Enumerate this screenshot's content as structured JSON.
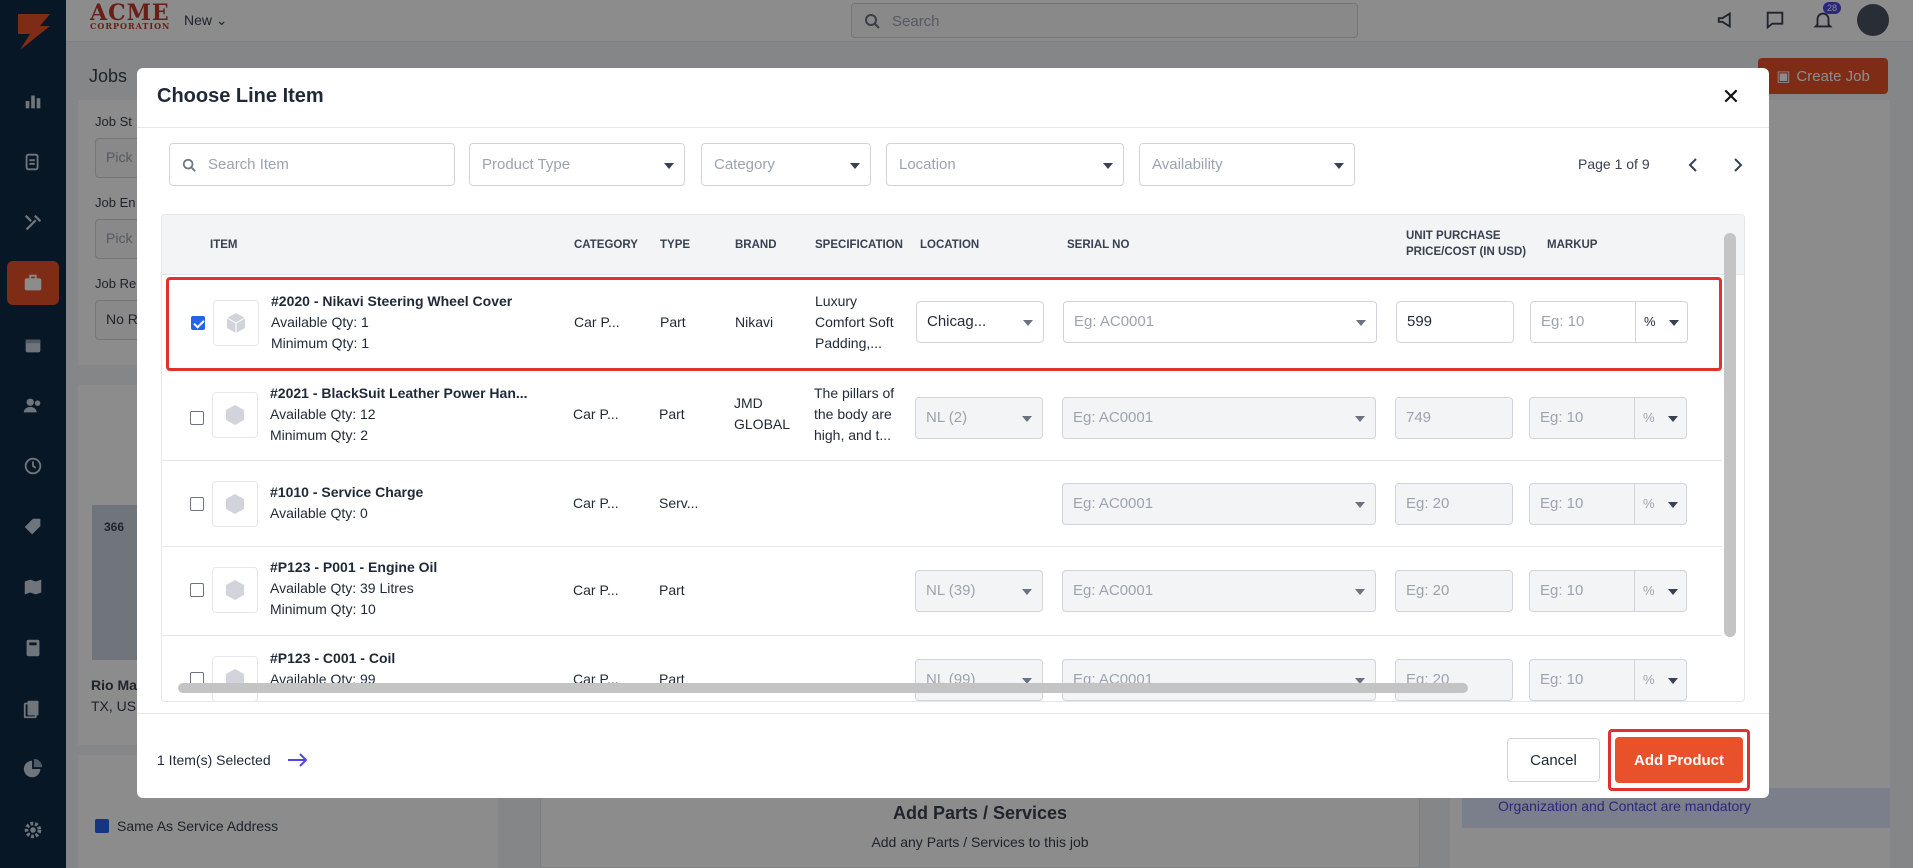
{
  "topbar": {
    "brand": "ACME",
    "brand_sub": "CORPORATION",
    "new_label": "New",
    "search_placeholder": "Search",
    "notification_count": "28"
  },
  "background": {
    "page_title": "Jobs",
    "create_job_label": "Create Job",
    "job_start_label": "Job St",
    "job_start_placeholder": "Pick",
    "job_end_label": "Job En",
    "job_end_placeholder": "Pick",
    "job_re_label": "Job Re",
    "job_re_value": "No R",
    "address_line1": "Rio Ma",
    "address_line2": "TX, US",
    "same_as_service": "Same As Service Address",
    "add_parts_title": "Add Parts / Services",
    "add_parts_sub": "Add any Parts / Services to this job",
    "mandatory_note": "Organization and Contact are mandatory",
    "map_route": "366"
  },
  "modal": {
    "title": "Choose Line Item",
    "filters": {
      "search_placeholder": "Search Item",
      "product_type": "Product Type",
      "category": "Category",
      "location": "Location",
      "availability": "Availability"
    },
    "pager": "Page 1 of 9",
    "columns": {
      "item": "ITEM",
      "category": "CATEGORY",
      "type": "TYPE",
      "brand": "BRAND",
      "specification": "SPECIFICATION",
      "location": "LOCATION",
      "serial": "SERIAL NO",
      "unit_price_l1": "UNIT PURCHASE",
      "unit_price_l2": "PRICE/COST (IN USD)",
      "markup": "MARKUP"
    },
    "rows": [
      {
        "name": "#2020 - Nikavi Steering Wheel Cover",
        "qty": "Available Qty: 1",
        "min": "Minimum Qty: 1",
        "category": "Car P...",
        "type": "Part",
        "brand": "Nikavi",
        "spec1": "Luxury",
        "spec2": "Comfort Soft",
        "spec3": "Padding,...",
        "location": "Chicag...",
        "serial": "Eg: AC0001",
        "price": "599",
        "markup": "Eg: 10",
        "checked": true
      },
      {
        "name": "#2021 - BlackSuit Leather Power Han...",
        "qty": "Available Qty: 12",
        "min": "Minimum Qty: 2",
        "category": "Car P...",
        "type": "Part",
        "brand1": "JMD",
        "brand2": "GLOBAL",
        "spec1": "The pillars of",
        "spec2": "the body are",
        "spec3": "high, and t...",
        "location": "NL (2)",
        "serial": "Eg: AC0001",
        "price": "749",
        "markup": "Eg: 10",
        "checked": false
      },
      {
        "name": "#1010 - Service Charge",
        "qty": "Available Qty: 0",
        "category": "Car P...",
        "type": "Serv...",
        "serial": "Eg: AC0001",
        "price": "Eg: 20",
        "markup": "Eg: 10",
        "checked": false
      },
      {
        "name": "#P123 - P001 - Engine Oil",
        "qty": "Available Qty: 39 Litres",
        "min": "Minimum Qty: 10",
        "category": "Car P...",
        "type": "Part",
        "location": "NL (39)",
        "serial": "Eg: AC0001",
        "price": "Eg: 20",
        "markup": "Eg: 10",
        "checked": false
      },
      {
        "name": "#P123 - C001 - Coil",
        "qty": "Available Qty: 99",
        "category": "Car P...",
        "type": "Part",
        "location": "NL (99)",
        "serial": "Eg: AC0001",
        "price": "Eg: 20",
        "markup": "Eg: 10",
        "checked": false
      }
    ],
    "markup_unit": "%",
    "footer": {
      "selected": "1 Item(s) Selected",
      "cancel": "Cancel",
      "add": "Add Product"
    }
  },
  "colors": {
    "sidebar": "#0f2b46",
    "accent": "#e8512a",
    "highlight": "#e03131"
  }
}
